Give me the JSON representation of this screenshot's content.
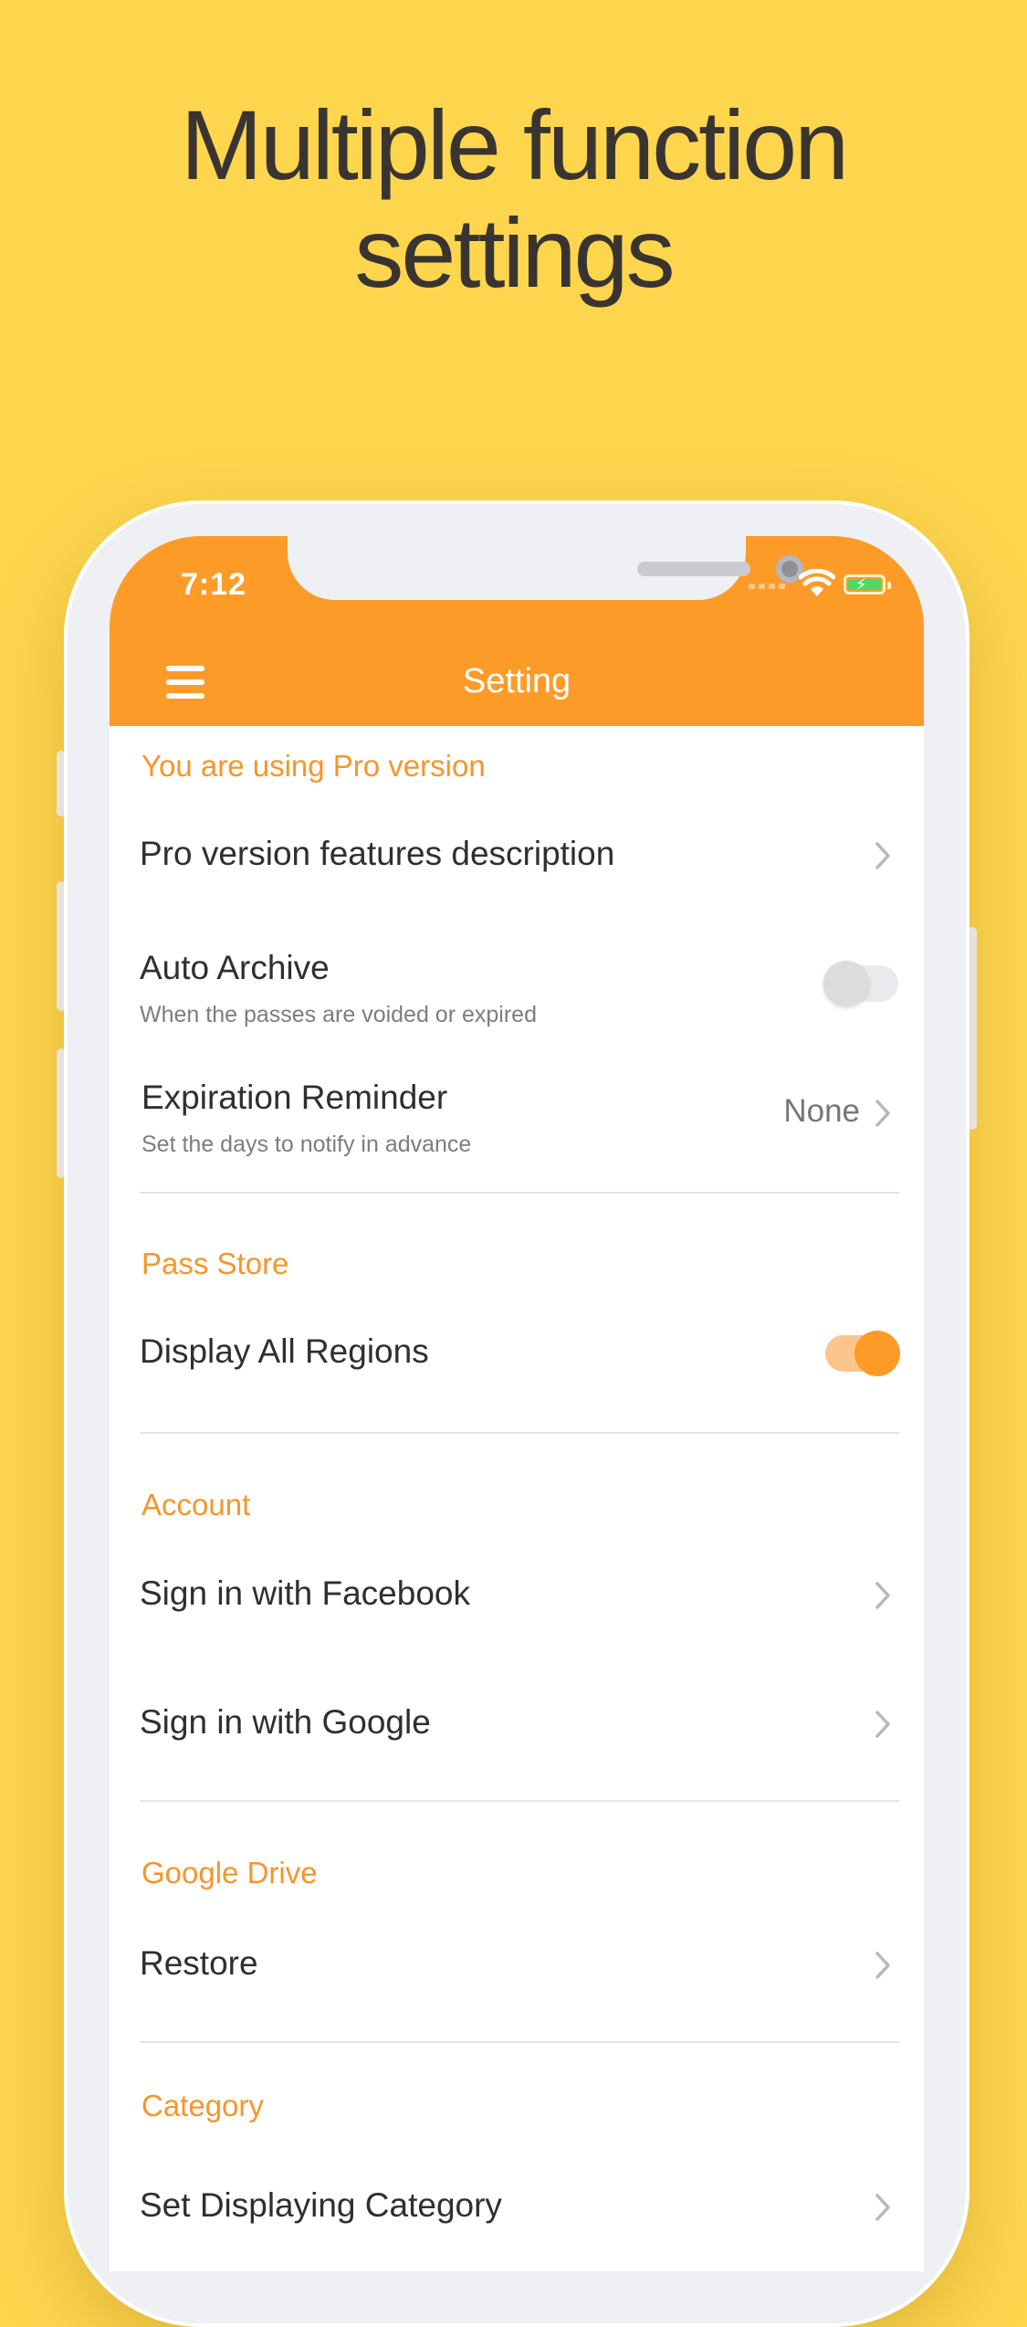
{
  "headline": {
    "line1": "Multiple function",
    "line2": "settings"
  },
  "status_bar": {
    "time": "7:12"
  },
  "nav": {
    "title": "Setting",
    "menu_icon": "hamburger-menu-icon"
  },
  "colors": {
    "background": "#fdd64e",
    "accent": "#fd9b29",
    "section_header": "#f5962a"
  },
  "sections": {
    "pro": {
      "header": "You are using Pro version",
      "features_row": {
        "title": "Pro version features description"
      },
      "auto_archive": {
        "title": "Auto Archive",
        "subtitle": "When the passes are voided or expired",
        "enabled": false
      },
      "expiration_reminder": {
        "title": "Expiration Reminder",
        "subtitle": "Set the days to notify in advance",
        "value": "None"
      }
    },
    "pass_store": {
      "header": "Pass Store",
      "display_all_regions": {
        "title": "Display All Regions",
        "enabled": true
      }
    },
    "account": {
      "header": "Account",
      "facebook": {
        "title": "Sign in with Facebook"
      },
      "google": {
        "title": "Sign in with Google"
      }
    },
    "google_drive": {
      "header": "Google Drive",
      "restore": {
        "title": "Restore"
      }
    },
    "category": {
      "header": "Category",
      "set_displaying": {
        "title": "Set Displaying Category"
      }
    }
  }
}
